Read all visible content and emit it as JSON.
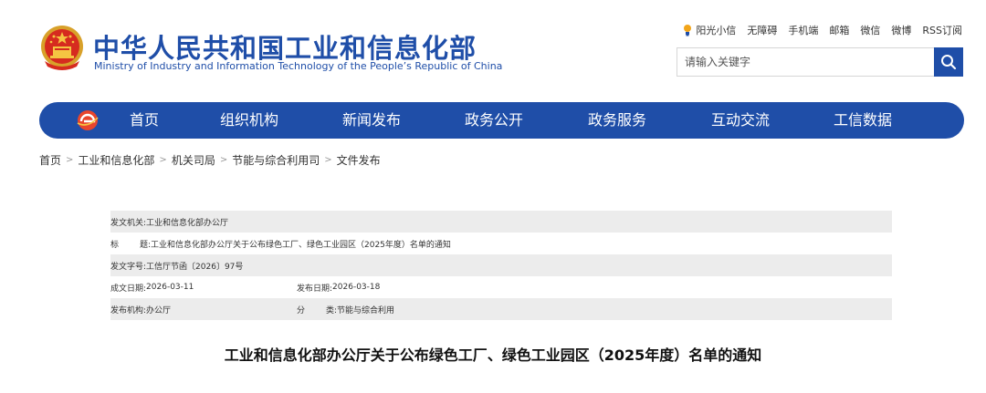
{
  "header": {
    "title": "中华人民共和国工业和信息化部",
    "subtitle": "Ministry of Industry and Information Technology of the People’s Republic of China"
  },
  "top_links": [
    "阳光小信",
    "无障碍",
    "手机端",
    "邮箱",
    "微信",
    "微博",
    "RSS订阅"
  ],
  "search": {
    "placeholder": "请输入关键字"
  },
  "nav": [
    "首页",
    "组织机构",
    "新闻发布",
    "政务公开",
    "政务服务",
    "互动交流",
    "工信数据"
  ],
  "breadcrumb": [
    "首页",
    "工业和信息化部",
    "机关司局",
    "节能与综合利用司",
    "文件发布"
  ],
  "breadcrumb_separator": ">",
  "info": {
    "issuer_label": "发文机关:",
    "issuer": "工业和信息化部办公厅",
    "title_label_a": "标",
    "title_label_b": "题:",
    "title": "工业和信息化部办公厅关于公布绿色工厂、绿色工业园区（2025年度）名单的通知",
    "doc_no_label": "发文字号:",
    "doc_no": "工信厅节函〔2026〕97号",
    "created_label": "成文日期:",
    "created": "2026-03-11",
    "published_label": "发布日期:",
    "published": "2026-03-18",
    "agency_label": "发布机构:",
    "agency": "办公厅",
    "category_label_a": "分",
    "category_label_b": "类:",
    "category": "节能与综合利用"
  },
  "article": {
    "title": "工业和信息化部办公厅关于公布绿色工厂、绿色工业园区（2025年度）名单的通知"
  },
  "colors": {
    "brand_blue": "#1f4ea8",
    "row_shade": "#ececec"
  }
}
